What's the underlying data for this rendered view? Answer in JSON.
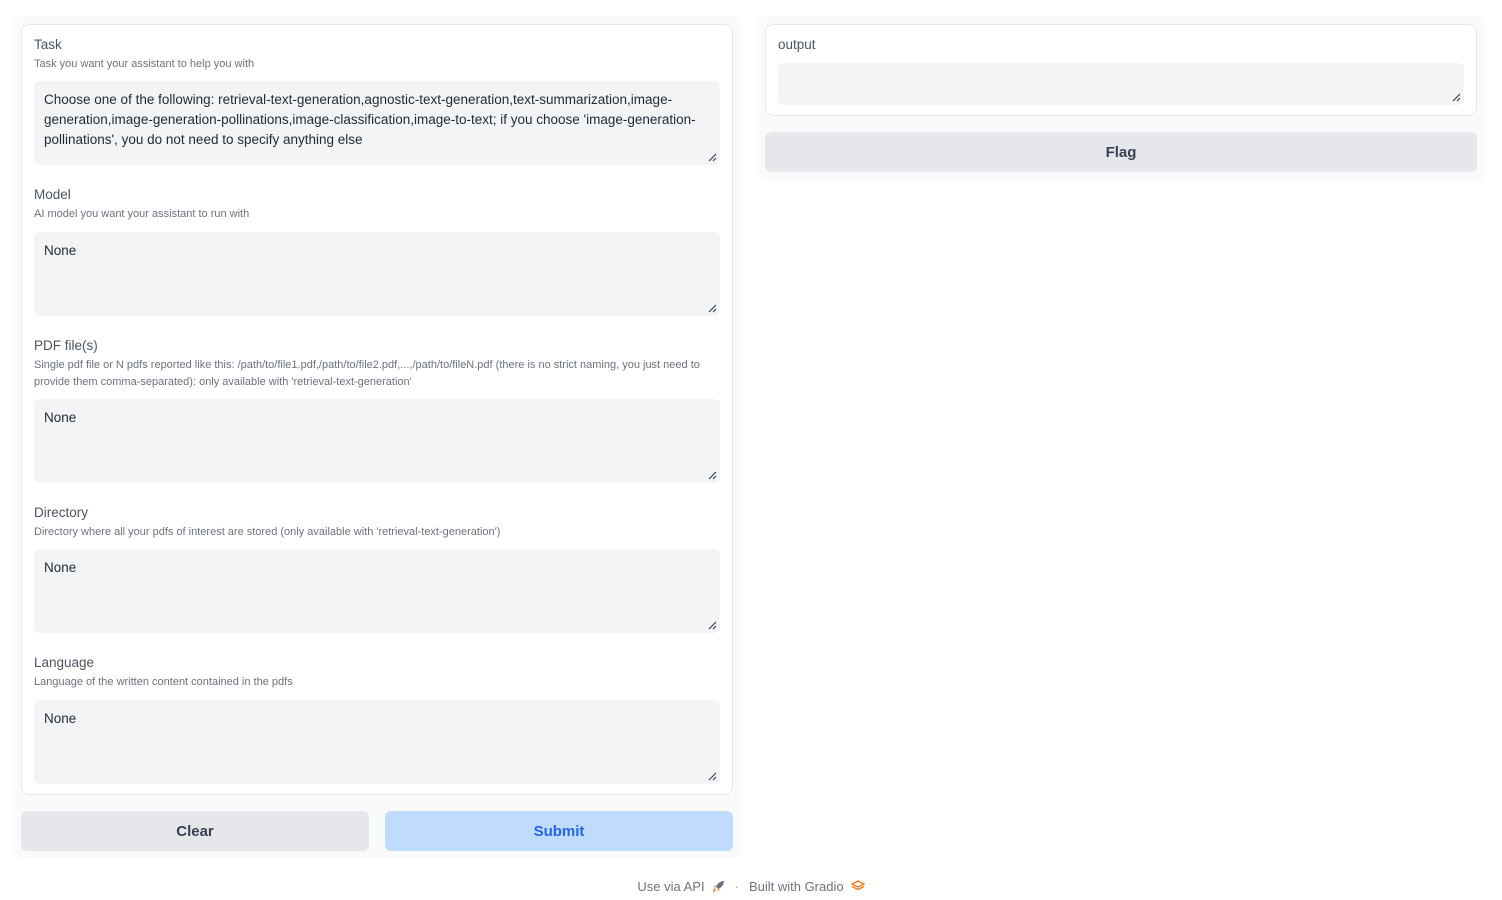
{
  "form": {
    "task": {
      "label": "Task",
      "info": "Task you want your assistant to help you with",
      "value": "Choose one of the following: retrieval-text-generation,agnostic-text-generation,text-summarization,image-generation,image-generation-pollinations,image-classification,image-to-text; if you choose 'image-generation-pollinations', you do not need to specify anything else"
    },
    "model": {
      "label": "Model",
      "info": "AI model you want your assistant to run with",
      "value": "None"
    },
    "pdf_files": {
      "label": "PDF file(s)",
      "info": "Single pdf file or N pdfs reported like this: /path/to/file1.pdf,/path/to/file2.pdf,...,/path/to/fileN.pdf (there is no strict naming, you just need to provide them comma-separated): only available with 'retrieval-text-generation'",
      "value": "None"
    },
    "directory": {
      "label": "Directory",
      "info": "Directory where all your pdfs of interest are stored (only available with 'retrieval-text-generation')",
      "value": "None"
    },
    "language": {
      "label": "Language",
      "info": "Language of the written content contained in the pdfs",
      "value": "None"
    }
  },
  "buttons": {
    "clear": "Clear",
    "submit": "Submit",
    "flag": "Flag"
  },
  "output": {
    "label": "output",
    "value": ""
  },
  "footer": {
    "api": "Use via API",
    "separator": "·",
    "built": "Built with Gradio"
  },
  "colors": {
    "submit_bg": "#bfdbfe",
    "submit_text": "#2563eb",
    "input_bg": "#f3f4f6",
    "panel_bg": "#f9fafb"
  }
}
